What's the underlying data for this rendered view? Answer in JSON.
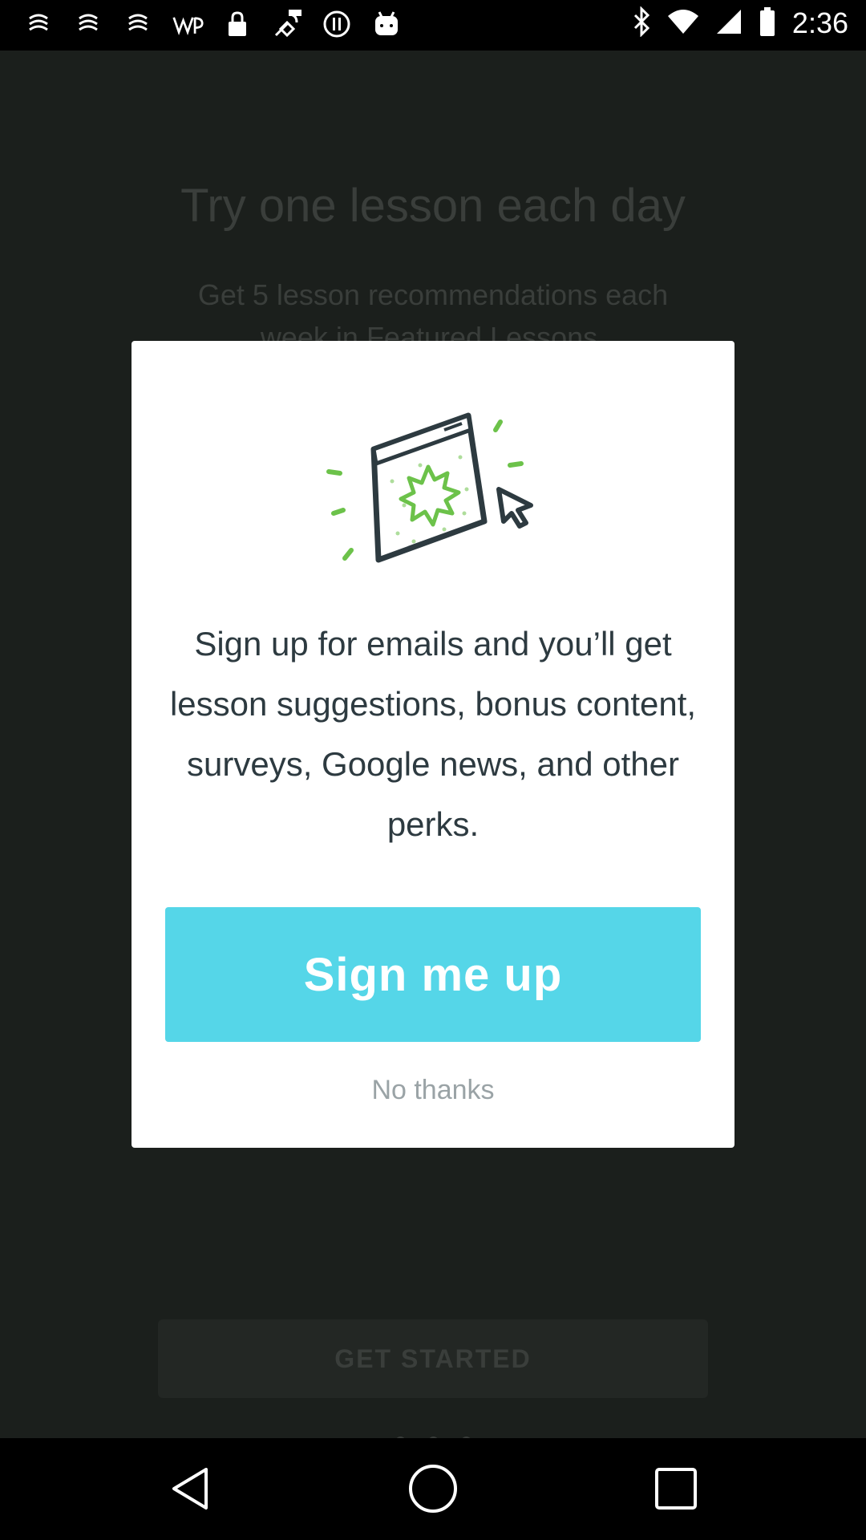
{
  "status_bar": {
    "time": "2:36",
    "icons": [
      "notification-icon",
      "notification-icon",
      "notification-icon",
      "wp-icon",
      "lock-icon",
      "fake-gps-icon",
      "pause-circle-icon",
      "android-icon",
      "bluetooth-icon",
      "wifi-icon",
      "signal-icon",
      "battery-icon"
    ]
  },
  "background": {
    "title": "Try one lesson each day",
    "subtitle": "Get 5 lesson recommendations each week in Featured Lessons.",
    "button_label": "GET STARTED",
    "page_indicator": {
      "count": 3,
      "active": 1
    }
  },
  "dialog": {
    "illustration_icon": "browser-window-cursor-icon",
    "body": "Sign up for emails and you’ll get lesson suggestions, bonus content, surveys, Google news, and other perks.",
    "primary_button": "Sign me up",
    "secondary_link": "No thanks",
    "colors": {
      "accent": "#55d6e8",
      "illustration_green": "#6cc24a",
      "illustration_stroke": "#2d3a40"
    }
  },
  "nav_bar": {
    "buttons": [
      "back-icon",
      "home-icon",
      "recents-icon"
    ]
  }
}
